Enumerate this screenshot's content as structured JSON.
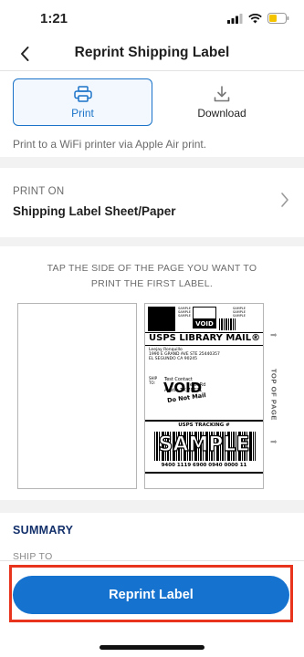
{
  "status_bar": {
    "time": "1:21"
  },
  "nav": {
    "title": "Reprint Shipping Label"
  },
  "options": {
    "print_label": "Print",
    "download_label": "Download"
  },
  "description": "Print to a WiFi printer via Apple Air print.",
  "print_on": {
    "caption": "PRINT ON",
    "value": "Shipping Label Sheet/Paper"
  },
  "preview": {
    "instruction_line1": "TAP THE SIDE OF THE PAGE YOU WANT TO",
    "instruction_line2": "PRINT THE FIRST LABEL.",
    "top_of_page": "TOP OF PAGE",
    "label": {
      "void_tag": "VOID",
      "sample_small": "SAMPLE",
      "service": "USPS LIBRARY MAIL®",
      "from_line1": "Leejay Ronquillo",
      "from_line2": "1990 E GRAND AVE STE 25440357",
      "from_line3": "EL SEGUNDO CA 90245",
      "ship_to_tag": "SHIP TO:",
      "to_line1": "Test Contact",
      "to_line2": "eek Rd",
      "to_line3": "Austin TX 78721",
      "void_big": "VOID",
      "do_not_mail": "Do Not Mail",
      "tracking_title": "USPS TRACKING #",
      "sample_big": "SAMPLE",
      "tracking_number": "9400 1119 6900 0940 0000 11"
    }
  },
  "summary": {
    "title": "SUMMARY",
    "ship_to": "SHIP TO"
  },
  "actions": {
    "reprint_label": "Reprint Label"
  },
  "colors": {
    "primary": "#1672cf",
    "highlight": "#e8341c",
    "summary_title": "#13306b"
  }
}
